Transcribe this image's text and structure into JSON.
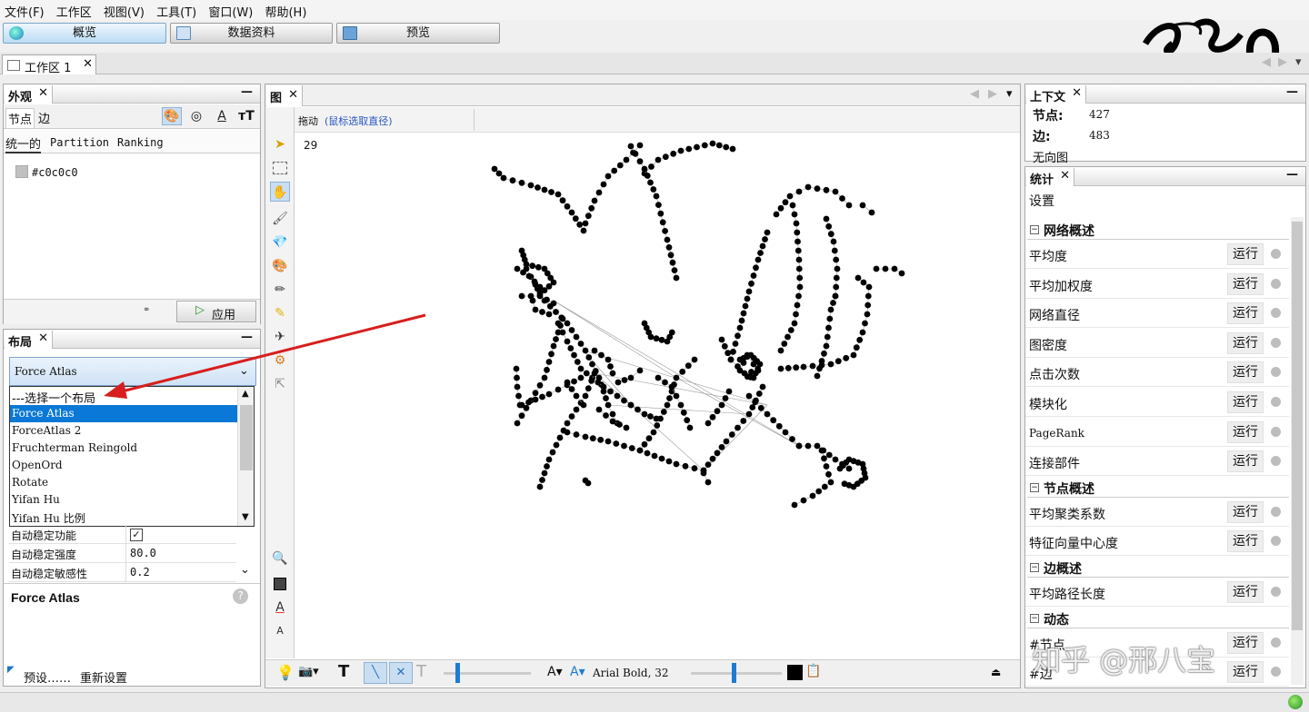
{
  "menu": [
    "文件(F)",
    "工作区",
    "视图(V)",
    "工具(T)",
    "窗口(W)",
    "帮助(H)"
  ],
  "modes": [
    {
      "label": "概览",
      "active": true
    },
    {
      "label": "数据资料",
      "active": false
    },
    {
      "label": "预览",
      "active": false
    }
  ],
  "workspace_tab": "工作区 1",
  "appearance": {
    "title": "外观",
    "subtabs": [
      "节点",
      "边"
    ],
    "modes": [
      "统一的",
      "Partition",
      "Ranking"
    ],
    "color_value": "#c0c0c0",
    "apply_label": "应用"
  },
  "layout": {
    "title": "布局",
    "selected": "Force Atlas",
    "options": [
      "---选择一个布局",
      "Force Atlas",
      "ForceAtlas 2",
      "Fruchterman Reingold",
      "OpenOrd",
      "Rotate",
      "Yifan Hu",
      "Yifan Hu 比例"
    ],
    "props": [
      {
        "key": "自动稳定功能",
        "value": "✓"
      },
      {
        "key": "自动稳定强度",
        "value": "80.0"
      },
      {
        "key": "自动稳定敏感性",
        "value": "0.2"
      }
    ],
    "description_title": "Force Atlas",
    "presets_label": "预设……",
    "reset_label": "重新设置"
  },
  "graph": {
    "title": "图",
    "drag_label": "拖动",
    "drag_hint": "(鼠标选取直径)",
    "counter": "29",
    "font_label": "Arial Bold, 32"
  },
  "context": {
    "title": "上下文",
    "nodes_label": "节点:",
    "nodes_value": "427",
    "edges_label": "边:",
    "edges_value": "483",
    "graph_type": "无向图"
  },
  "statistics": {
    "title": "统计",
    "settings_label": "设置",
    "run_label": "运行",
    "sections": [
      {
        "title": "网络概述",
        "items": [
          "平均度",
          "平均加权度",
          "网络直径",
          "图密度",
          "点击次数",
          "模块化",
          "PageRank",
          "连接部件"
        ]
      },
      {
        "title": "节点概述",
        "items": [
          "平均聚类系数",
          "特征向量中心度"
        ]
      },
      {
        "title": "边概述",
        "items": [
          "平均路径长度"
        ]
      },
      {
        "title": "动态",
        "items": [
          "#节点",
          "#边"
        ]
      }
    ]
  },
  "watermark": "知乎 @邢八宝",
  "colors": {
    "accent": "#0a78d7",
    "arrow": "#d81e1e",
    "active_button": "#bcdcf4"
  }
}
